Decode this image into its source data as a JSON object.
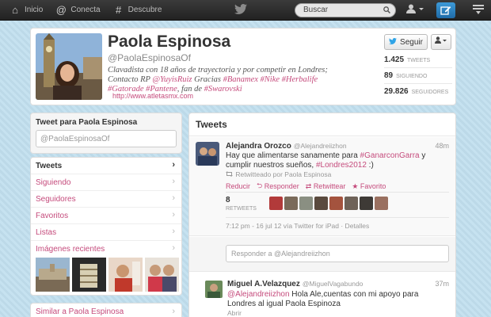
{
  "topbar": {
    "home": "Inicio",
    "connect": "Conecta",
    "discover": "Descubre",
    "search_placeholder": "Buscar"
  },
  "profile": {
    "name": "Paola Espinosa",
    "handle": "@PaolaEspinosaOf",
    "bio_line1": "Clavadista con 18 años de trayectoria y por competir en Londres;",
    "bio_line2_prefix": "Contacto RP ",
    "bio_mention": "@YuyisRuiz",
    "bio_line2_mid": " Gracias ",
    "bio_tags_line2": "#Banamex #Nike #Herbalife",
    "bio_tags_line3a": "#Gatorade #Pantene",
    "bio_line3_mid": ", fan de ",
    "bio_tags_line3b": "#Swarovski",
    "url": "http://www.atletasmx.com",
    "follow_label": "Seguir",
    "stats": [
      {
        "value": "1.425",
        "label": "TWEETS"
      },
      {
        "value": "89",
        "label": "SIGUIENDO"
      },
      {
        "value": "29.826",
        "label": "SEGUIDORES"
      }
    ]
  },
  "compose": {
    "title": "Tweet para Paola Espinosa",
    "placeholder": "@PaolaEspinosaOf"
  },
  "nav": {
    "items": [
      {
        "label": "Tweets"
      },
      {
        "label": "Siguiendo"
      },
      {
        "label": "Seguidores"
      },
      {
        "label": "Favoritos"
      },
      {
        "label": "Listas"
      },
      {
        "label": "Imágenes recientes"
      }
    ]
  },
  "similar": "Similar a Paola Espinosa",
  "timeline": {
    "title": "Tweets",
    "tweet1": {
      "name": "Alejandra Orozco",
      "handle": "@Alejandreiizhon",
      "time": "48m",
      "text_a": "Hay que alimentarse sanamente para ",
      "tag1": "#GanarconGarra",
      "text_b": " y cumplir nuestros sueños, ",
      "tag2": "#Londres2012",
      "text_c": " :)",
      "retweeted_by": "Retwitteado por Paola Espinosa",
      "actions": [
        "Reducir",
        "Responder",
        "Retwittear",
        "Favorito"
      ],
      "retweet_count": "8",
      "retweet_label": "RETWEETS",
      "meta": "7:12 pm - 16 jul 12 vía Twitter for iPad · Detalles"
    },
    "reply_placeholder": "Responder a @Alejandreiizhon",
    "tweet2": {
      "name": "Miguel A.Velazquez",
      "handle": "@MiguelVagabundo",
      "time": "37m",
      "mention": "@Alejandreiizhon",
      "text": " Hola Ale,cuentas con mi apoyo para Londres al igual Paola Espinoza",
      "open": "Abrir"
    }
  },
  "colors": {
    "link": "#c54b7c",
    "topbar": "#2a2a2a",
    "background": "#c0deed"
  }
}
